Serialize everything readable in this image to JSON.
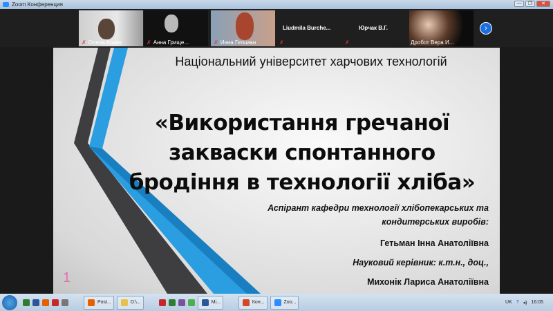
{
  "window": {
    "title": "Zoom Конференция",
    "min": "—",
    "max": "❐",
    "close": "✕"
  },
  "participants": [
    {
      "name": "Олена Кохан",
      "video": true
    },
    {
      "name": "Анна Грище...",
      "video": true
    },
    {
      "name": "Инна Гетьман",
      "video": true
    },
    {
      "name": "Liudmila  Burche...",
      "video": false
    },
    {
      "name": "Юрчак В.Г.",
      "video": false
    },
    {
      "name": "Дробот Вера И...",
      "video": true
    }
  ],
  "next_label": "›",
  "slide": {
    "university": "Національний університет харчових технологій",
    "title_lines": [
      "«Використання гречаної",
      "закваски спонтанного",
      "бродіння в технології хліба»"
    ],
    "role": "Аспірант кафедри технології хлібопекарських та",
    "role2": "кондитерських виробів:",
    "author": "Гетьман Інна Анатоліївна",
    "advisor_label": "Науковий керівник: к.т.н., доц.,",
    "advisor": "Михонік Лариса Анатоліївна",
    "page_number": "1",
    "colors": {
      "blue": "#2a9ee0",
      "dark": "#3e3e40"
    }
  },
  "taskbar": {
    "buttons": [
      "Post...",
      "D:\\...",
      "Mi...",
      "Кон...",
      "Zoo..."
    ],
    "lang": "UK",
    "time": "16:05"
  }
}
